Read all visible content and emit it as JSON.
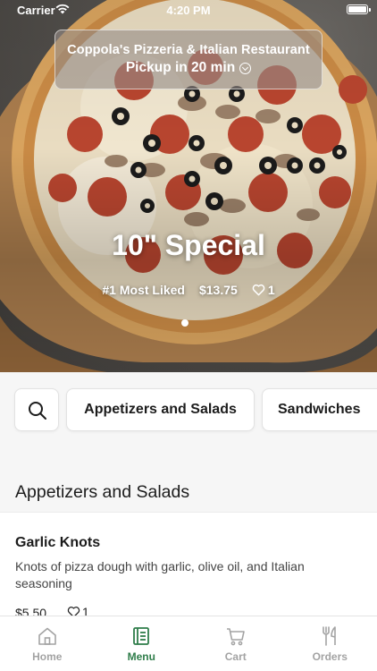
{
  "status_bar": {
    "carrier": "Carrier",
    "time": "4:20 PM"
  },
  "store": {
    "name": "Coppola's Pizzeria & Italian Restaurant",
    "pickup": "Pickup in 20 min"
  },
  "featured": {
    "title": "10\" Special",
    "rank": "#1 Most Liked",
    "price": "$13.75",
    "likes": "1"
  },
  "categories": {
    "items": [
      "Appetizers and Salads",
      "Sandwiches"
    ]
  },
  "section": {
    "title": "Appetizers and Salads"
  },
  "menu_item": {
    "name": "Garlic Knots",
    "description": "Knots of pizza dough with garlic, olive oil, and Italian seasoning",
    "price": "$5.50",
    "likes": "1"
  },
  "tabs": [
    {
      "label": "Home",
      "icon": "home-icon",
      "active": false
    },
    {
      "label": "Menu",
      "icon": "menu-book-icon",
      "active": true
    },
    {
      "label": "Cart",
      "icon": "cart-icon",
      "active": false
    },
    {
      "label": "Orders",
      "icon": "fork-knife-icon",
      "active": false
    }
  ],
  "colors": {
    "accent": "#2f7d4a",
    "inactive_tab": "#a3a3a3",
    "background": "#f6f6f6"
  }
}
